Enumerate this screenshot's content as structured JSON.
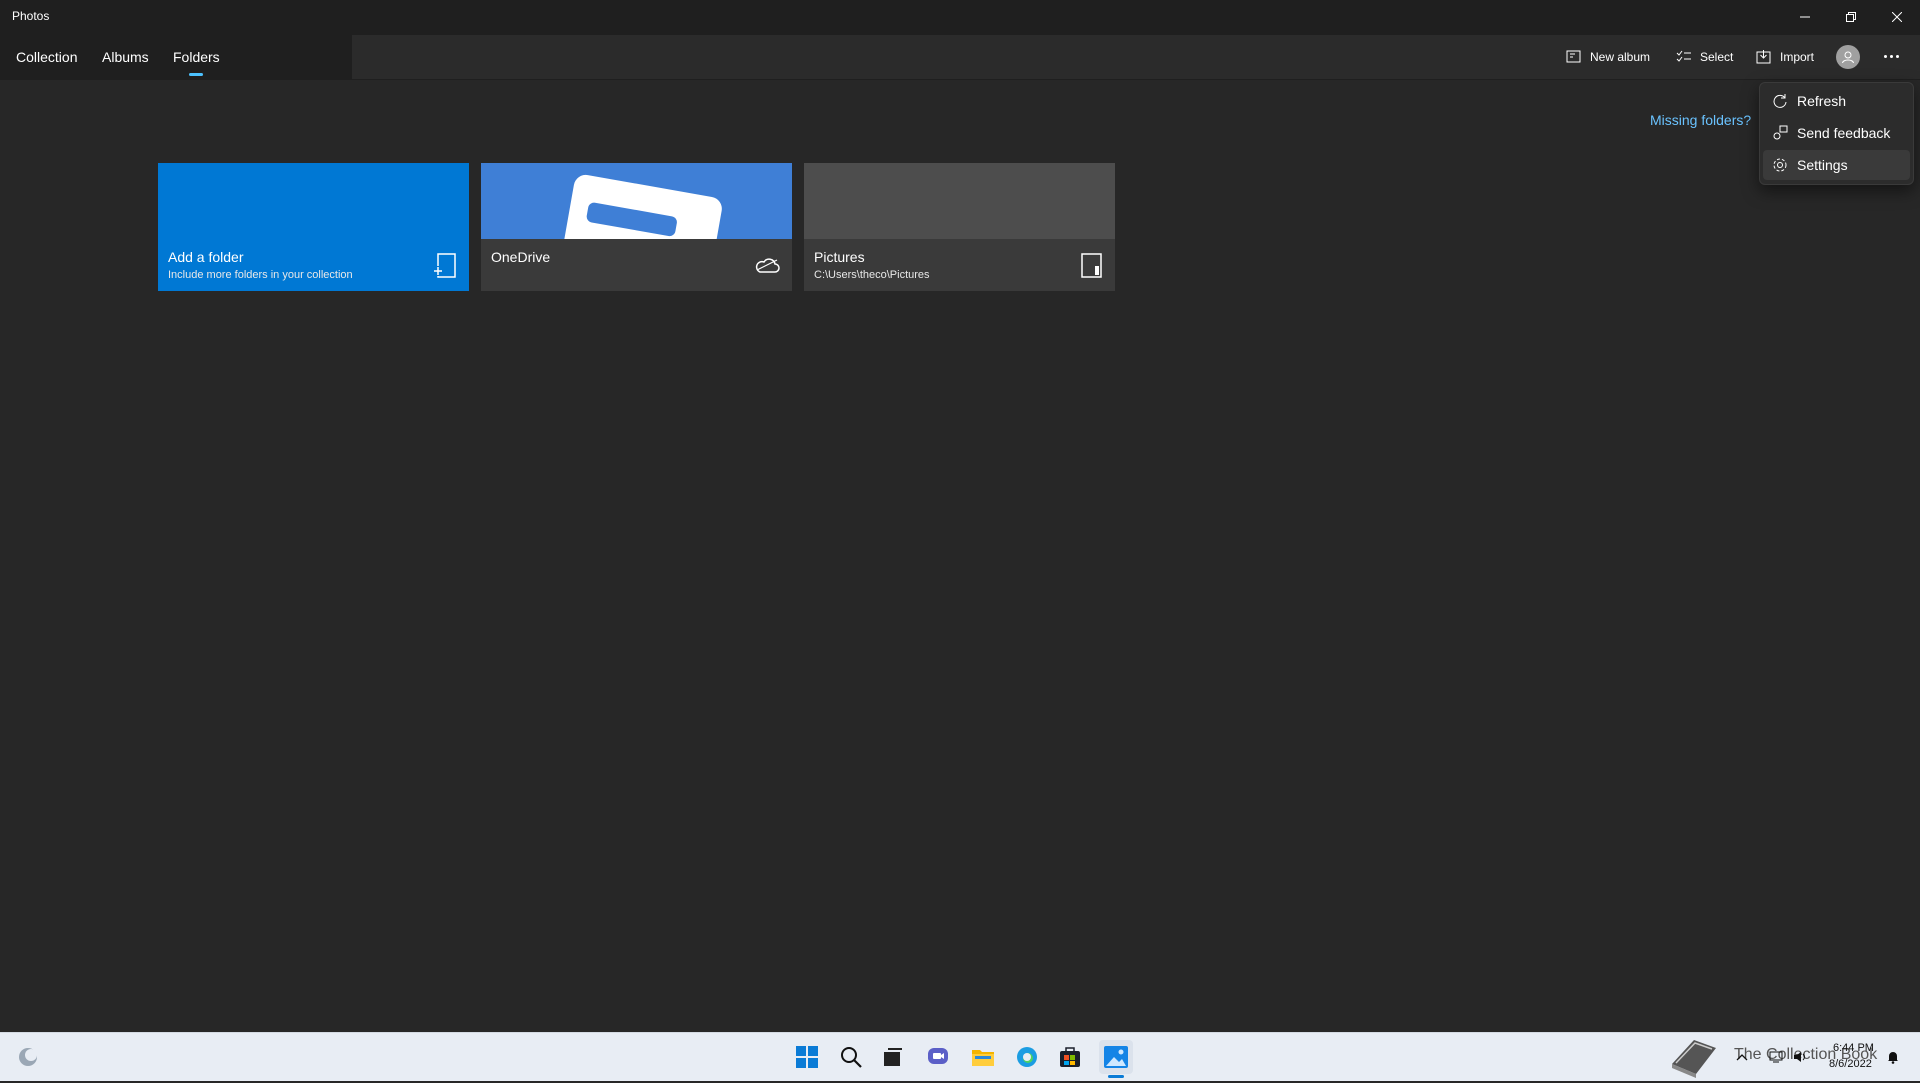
{
  "window": {
    "title": "Photos"
  },
  "nav": {
    "tabs": [
      {
        "label": "Collection"
      },
      {
        "label": "Albums"
      },
      {
        "label": "Folders",
        "active": true
      }
    ]
  },
  "toolbar": {
    "new_album": "New album",
    "select": "Select",
    "import": "Import"
  },
  "missing_folders": "Missing folders?",
  "menu": {
    "items": [
      {
        "label": "Refresh",
        "icon": "refresh-icon"
      },
      {
        "label": "Send feedback",
        "icon": "feedback-icon"
      },
      {
        "label": "Settings",
        "icon": "gear-icon",
        "hovered": true
      }
    ]
  },
  "tiles": [
    {
      "title": "Add a folder",
      "subtitle": "Include more folders in your collection",
      "icon": "add-folder-icon",
      "color": "#0078d4"
    },
    {
      "title": "OneDrive",
      "icon": "cloud-icon",
      "color": "#3a3a3a"
    },
    {
      "title": "Pictures",
      "subtitle": "C:\\Users\\theco\\Pictures",
      "icon": "device-icon",
      "color": "#3a3a3a"
    }
  ],
  "taskbar": {
    "apps": [
      "start-icon",
      "search-icon",
      "task-view-icon",
      "chat-icon",
      "file-explorer-icon",
      "edge-icon",
      "store-icon",
      "photos-icon"
    ],
    "watermark": "The Collection Book",
    "time": "6:44 PM",
    "date": "8/6/2022"
  },
  "colors": {
    "accent": "#0078d4",
    "link": "#6ac3ff",
    "background": "#272727",
    "tab_indicator": "#4cc2ff"
  }
}
